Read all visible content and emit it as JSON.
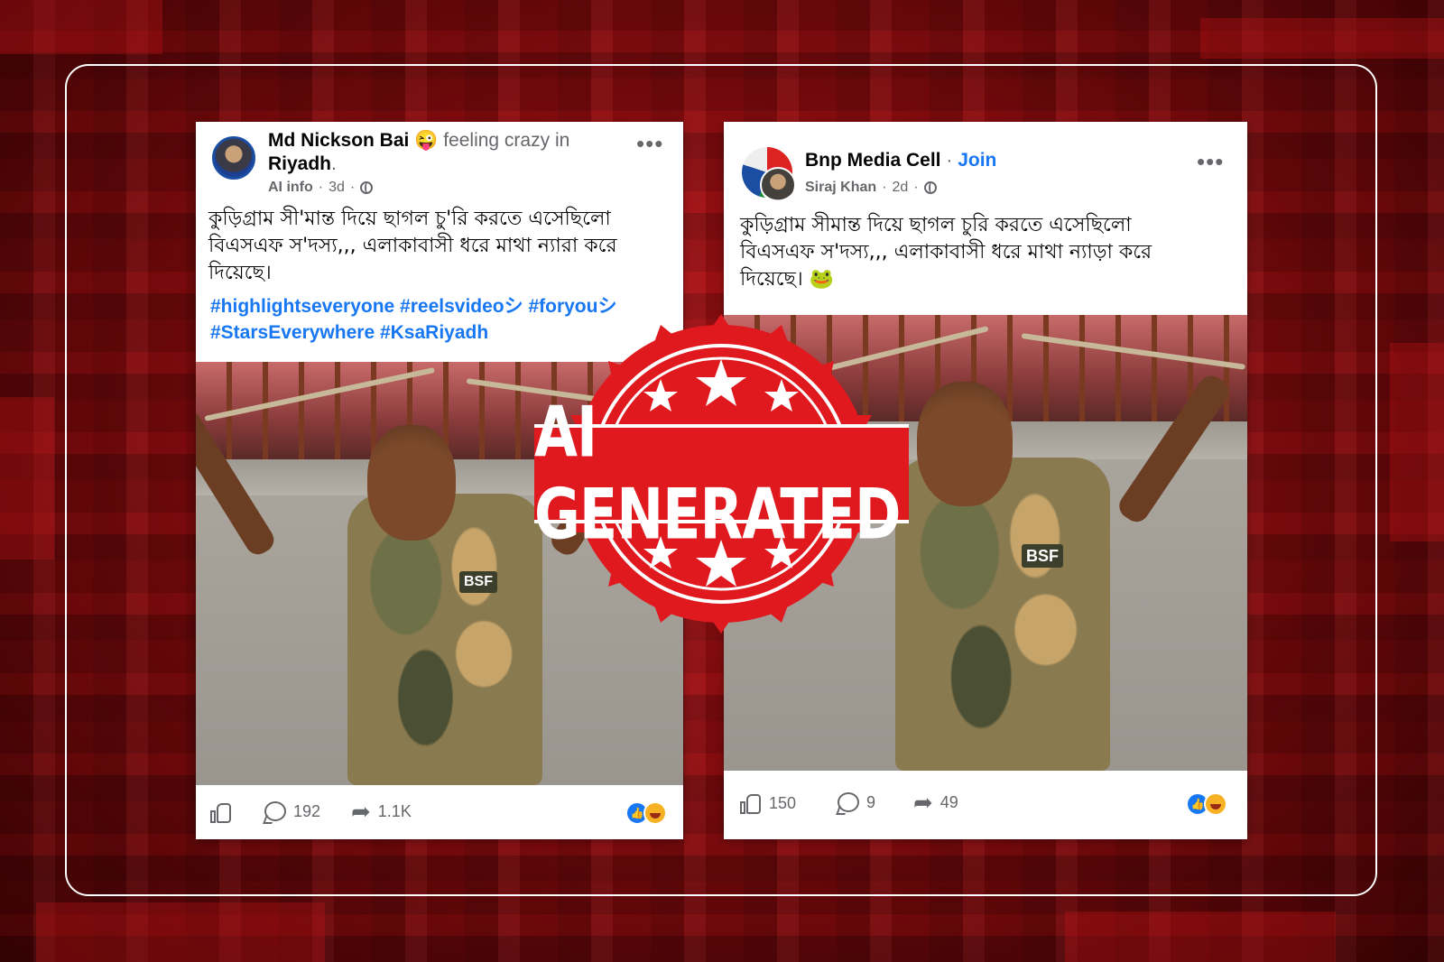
{
  "post1": {
    "author": "Md Nickson Bai",
    "feeling_emoji": "😜",
    "feeling_text": "feeling crazy in",
    "location": "Riyadh",
    "location_suffix": ".",
    "meta_label": "AI info",
    "time": "3d",
    "more": "•••",
    "body_line1": "কুড়িগ্রাম সী'মান্ত দিয়ে ছাগল চু'রি করতে এসেছিলো",
    "body_line2": "বিএসএফ স'দস্য,,, এলাকাবাসী ধরে মাথা ন্যারা করে",
    "body_line3": "দিয়েছে।",
    "hashtags_line1": "#highlightseveryone #reelsvideoシ #foryouシ",
    "hashtags_line2": "#StarsEverywhere #KsaRiyadh",
    "badge_text": "BSF",
    "comments": "192",
    "shares": "1.1K"
  },
  "post2": {
    "author": "Bnp Media Cell",
    "separator": " · ",
    "join": "Join",
    "member": "Siraj Khan",
    "time": "2d",
    "more": "•••",
    "body_line1": "কুড়িগ্রাম সীমান্ত দিয়ে ছাগল চুরি করতে এসেছিলো",
    "body_line2": "বিএসএফ স'দস্য,,, এলাকাবাসী ধরে মাথা ন্যাড়া করে",
    "body_line3": "দিয়েছে। 🐸",
    "badge_text": "BSF",
    "likes": "150",
    "comments": "9",
    "shares": "49"
  },
  "stamp": {
    "label": "AI GENERATED",
    "color": "#e0191f"
  },
  "colors": {
    "link": "#1877f2",
    "background": "#8a0b0e"
  }
}
